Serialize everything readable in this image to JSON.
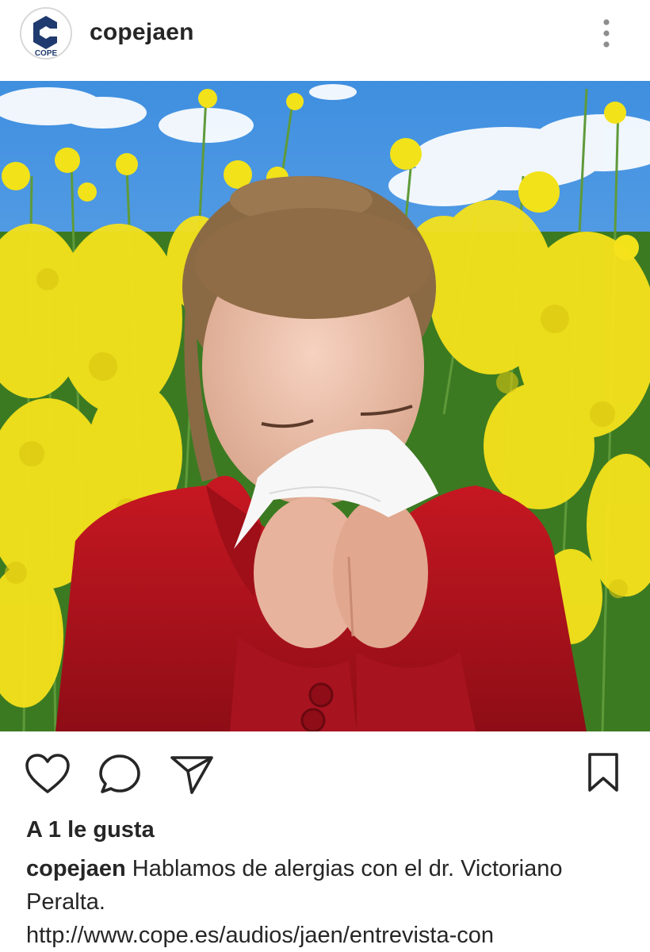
{
  "header": {
    "username": "copejaen",
    "avatar_text": "COPE",
    "more_icon": "more-vertical-icon"
  },
  "post": {
    "photo_alt": "Mujer sonándose la nariz con un pañuelo en un campo de flores amarillas",
    "actions": {
      "like_icon": "heart-icon",
      "comment_icon": "comment-icon",
      "share_icon": "send-icon",
      "save_icon": "bookmark-icon"
    },
    "likes_text": "A 1 le gusta",
    "caption": {
      "username": "copejaen",
      "text_line1": "Hablamos de alergias con el dr. Victoriano",
      "text_line2": "Peralta.",
      "link": "http://www.cope.es/audios/jaen/entrevista-con"
    }
  },
  "colors": {
    "brand_blue": "#1f3a6e",
    "text": "#262626",
    "sky": "#5aa0e4",
    "flowers": "#f2e21a",
    "jacket": "#b3141e"
  }
}
